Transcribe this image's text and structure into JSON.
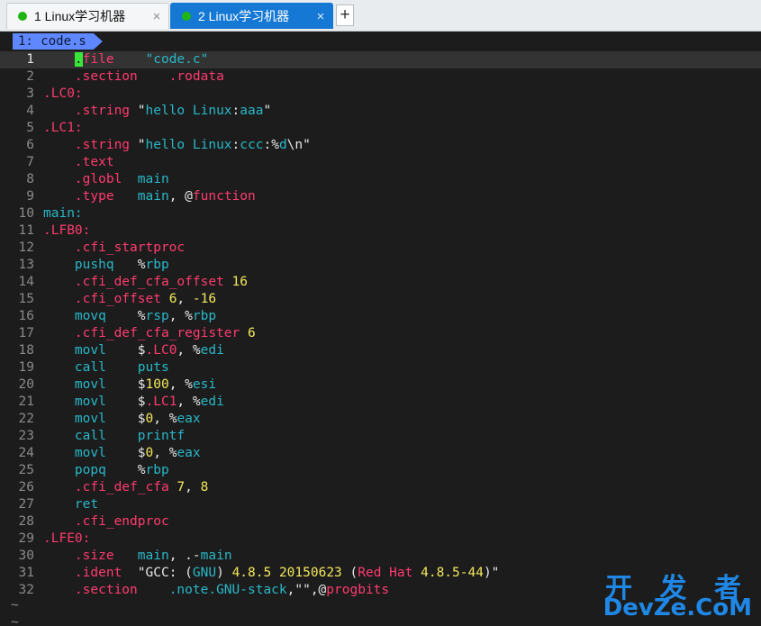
{
  "tabs": [
    {
      "label": "1 Linux学习机器",
      "close": "×"
    },
    {
      "label": "2 Linux学习机器",
      "close": "×"
    }
  ],
  "new_tab": "+",
  "buffer_tab": "1: code.s",
  "numbers": [
    "1",
    "2",
    "3",
    "4",
    "5",
    "6",
    "7",
    "8",
    "9",
    "10",
    "11",
    "12",
    "13",
    "14",
    "15",
    "16",
    "17",
    "18",
    "19",
    "20",
    "21",
    "22",
    "23",
    "24",
    "25",
    "26",
    "27",
    "28",
    "29",
    "30",
    "31",
    "32"
  ],
  "tilde": "~",
  "watermark": {
    "top": "开 发 者",
    "bottom": "DevZe.CoM"
  },
  "src": {
    "l1": {
      "cursor": ".",
      "a": "file",
      "b": "\"code.c\""
    },
    "l2": {
      "a": ".section",
      "b": ".rodata"
    },
    "l3": {
      "a": ".LC0:"
    },
    "l4": {
      "a": ".string",
      "b": "\"",
      "c": "hello Linux",
      "d": ":",
      "e": "aaa",
      "f": "\""
    },
    "l5": {
      "a": ".LC1:"
    },
    "l6": {
      "a": ".string",
      "b": "\"",
      "c": "hello Linux",
      "d": ":",
      "e": "ccc",
      "f": ":%",
      "g": "d",
      "h": "\\n",
      "i": "\""
    },
    "l7": {
      "a": ".text"
    },
    "l8": {
      "a": ".globl",
      "b": "main"
    },
    "l9": {
      "a": ".type",
      "b": "main",
      "c": ", @",
      "d": "function"
    },
    "l10": {
      "a": "main:"
    },
    "l11": {
      "a": ".LFB0:"
    },
    "l12": {
      "a": ".cfi_startproc"
    },
    "l13": {
      "a": "pushq",
      "b": "%",
      "c": "rbp"
    },
    "l14": {
      "a": ".cfi_def_cfa_offset",
      "b": "16"
    },
    "l15": {
      "a": ".cfi_offset",
      "b": "6",
      "c": ", ",
      "d": "-16"
    },
    "l16": {
      "a": "movq",
      "b": "%",
      "c": "rsp",
      "d": ", %",
      "e": "rbp"
    },
    "l17": {
      "a": ".cfi_def_cfa_register",
      "b": "6"
    },
    "l18": {
      "a": "movl",
      "b": "$",
      "c": ".LC0",
      "d": ", %",
      "e": "edi"
    },
    "l19": {
      "a": "call",
      "b": "puts"
    },
    "l20": {
      "a": "movl",
      "b": "$",
      "c": "100",
      "d": ", %",
      "e": "esi"
    },
    "l21": {
      "a": "movl",
      "b": "$",
      "c": ".LC1",
      "d": ", %",
      "e": "edi"
    },
    "l22": {
      "a": "movl",
      "b": "$",
      "c": "0",
      "d": ", %",
      "e": "eax"
    },
    "l23": {
      "a": "call",
      "b": "printf"
    },
    "l24": {
      "a": "movl",
      "b": "$",
      "c": "0",
      "d": ", %",
      "e": "eax"
    },
    "l25": {
      "a": "popq",
      "b": "%",
      "c": "rbp"
    },
    "l26": {
      "a": ".cfi_def_cfa",
      "b": "7",
      "c": ", ",
      "d": "8"
    },
    "l27": {
      "a": "ret"
    },
    "l28": {
      "a": ".cfi_endproc"
    },
    "l29": {
      "a": ".LFE0:"
    },
    "l30": {
      "a": ".size",
      "b": "main",
      "c": ", .-",
      "d": "main"
    },
    "l31": {
      "a": ".ident",
      "b": "\"GCC: (",
      "c": "GNU",
      "d": ") ",
      "e": "4.8.5",
      "f": " ",
      "g": "20150623",
      "h": " (",
      "i": "Red Hat",
      "j": " ",
      "k": "4.8.5-44",
      "l": ")\""
    },
    "l32": {
      "a": ".section",
      "b": ".note.GNU-stack",
      "c": ",\"\",@",
      "d": "progbits"
    }
  },
  "colors": {
    "directive": "#ff3b6f",
    "instruction": "#28b8c8",
    "number": "#f4e85c",
    "cursor": "#39e639",
    "buffer_tab": "#5f87ff",
    "active_tab": "#1478d4"
  }
}
